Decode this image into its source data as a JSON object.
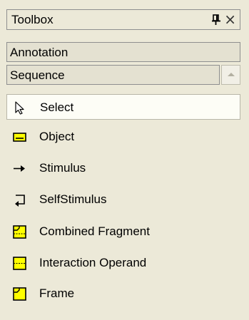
{
  "toolbox": {
    "title": "Toolbox",
    "pin_icon": "pin-icon",
    "close_glyph": "×"
  },
  "sections": {
    "annotation": {
      "label": "Annotation"
    },
    "sequence": {
      "label": "Sequence"
    }
  },
  "items": [
    {
      "label": "Select",
      "icon": "pointer-arrow-icon",
      "selected": true
    },
    {
      "label": "Object",
      "icon": "object-box-icon"
    },
    {
      "label": "Stimulus",
      "icon": "right-arrow-icon"
    },
    {
      "label": "SelfStimulus",
      "icon": "self-loop-arrow-icon"
    },
    {
      "label": "Combined Fragment",
      "icon": "combined-fragment-icon"
    },
    {
      "label": "Interaction Operand",
      "icon": "interaction-operand-icon"
    },
    {
      "label": "Frame",
      "icon": "frame-icon"
    }
  ],
  "colors": {
    "background": "#ECE9D8",
    "icon_yellow": "#FFFF00",
    "selected_bg": "#FDFDF6"
  }
}
